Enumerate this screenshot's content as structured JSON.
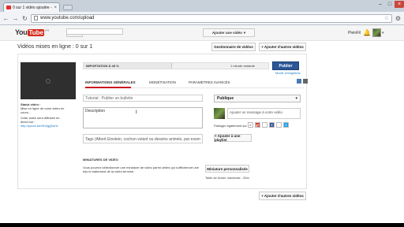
{
  "browser": {
    "tab_title": "0 sur 1 vidéo ajoutée - YouTube",
    "tab_close": "×",
    "url": "www.youtube.com/upload",
    "back": "←",
    "forward": "→",
    "reload": "↻",
    "star": "☆",
    "wrench": "⚙",
    "min": "–",
    "max": "□",
    "close": "×"
  },
  "header": {
    "logo_you": "You",
    "logo_tube": "Tube",
    "logo_region": "FR",
    "search_placeholder": "",
    "search_icon": "⌕",
    "add_video_label": "Ajouter une vidéo",
    "add_video_caret": "▾",
    "username": "PleinFil",
    "bell": "🔔",
    "avatar_caret": "▾"
  },
  "page": {
    "title": "Vidéos mises en ligne : 0 sur 1",
    "manager_button": "Gestionnaire de vidéos",
    "add_more_label": "+ Ajouter d'autres vidéos"
  },
  "upload": {
    "progress_label": "IMPORTATION À 48 %",
    "progress_value": 0.48,
    "time_remaining": "1 minute restante",
    "publish_label": "Publier",
    "draft_link": "Modif. enregistrés",
    "left_status_label": "Statut vidéo :",
    "left_status_text": "Mise en ligne de votre vidéo en cours…",
    "left_url_label": "Votre vidéo sera diffusée en direct sur :",
    "left_url": "http://youtu.be/HhZgg5uHL"
  },
  "tabs": [
    {
      "label": "INFORMATIONS GÉNÉRALES"
    },
    {
      "label": "MONÉTISATION"
    },
    {
      "label": "PARAMÈTRES AVANCÉS"
    }
  ],
  "form": {
    "title_value": "Tutorial : Publier un bulletin",
    "description_placeholder": "Description",
    "cursor_glyph": "I",
    "tags_placeholder": "Tags (Albert Einstein, cochon volant ou dessins animés, par exem",
    "miniature_title": "MINIATURES DE VIDÉO",
    "miniature_desc": "Vous pourrez sélectionner une miniature de vidéo parmi celles qui s'afficheront une fois le traitement de la vidéo terminé.",
    "custom_thumb_button": "Miniature personnalisée",
    "max_size": "Taille de fichier maximale : 2Mo",
    "privacy_value": "Publique",
    "privacy_caret": "▾",
    "share_message_placeholder": "Ajouter un message à votre vidéo",
    "share_label": "Partager également sur",
    "social": [
      "✓",
      "g+",
      "f",
      "t"
    ],
    "playlist_button": "+ Ajouter à une playlist"
  }
}
